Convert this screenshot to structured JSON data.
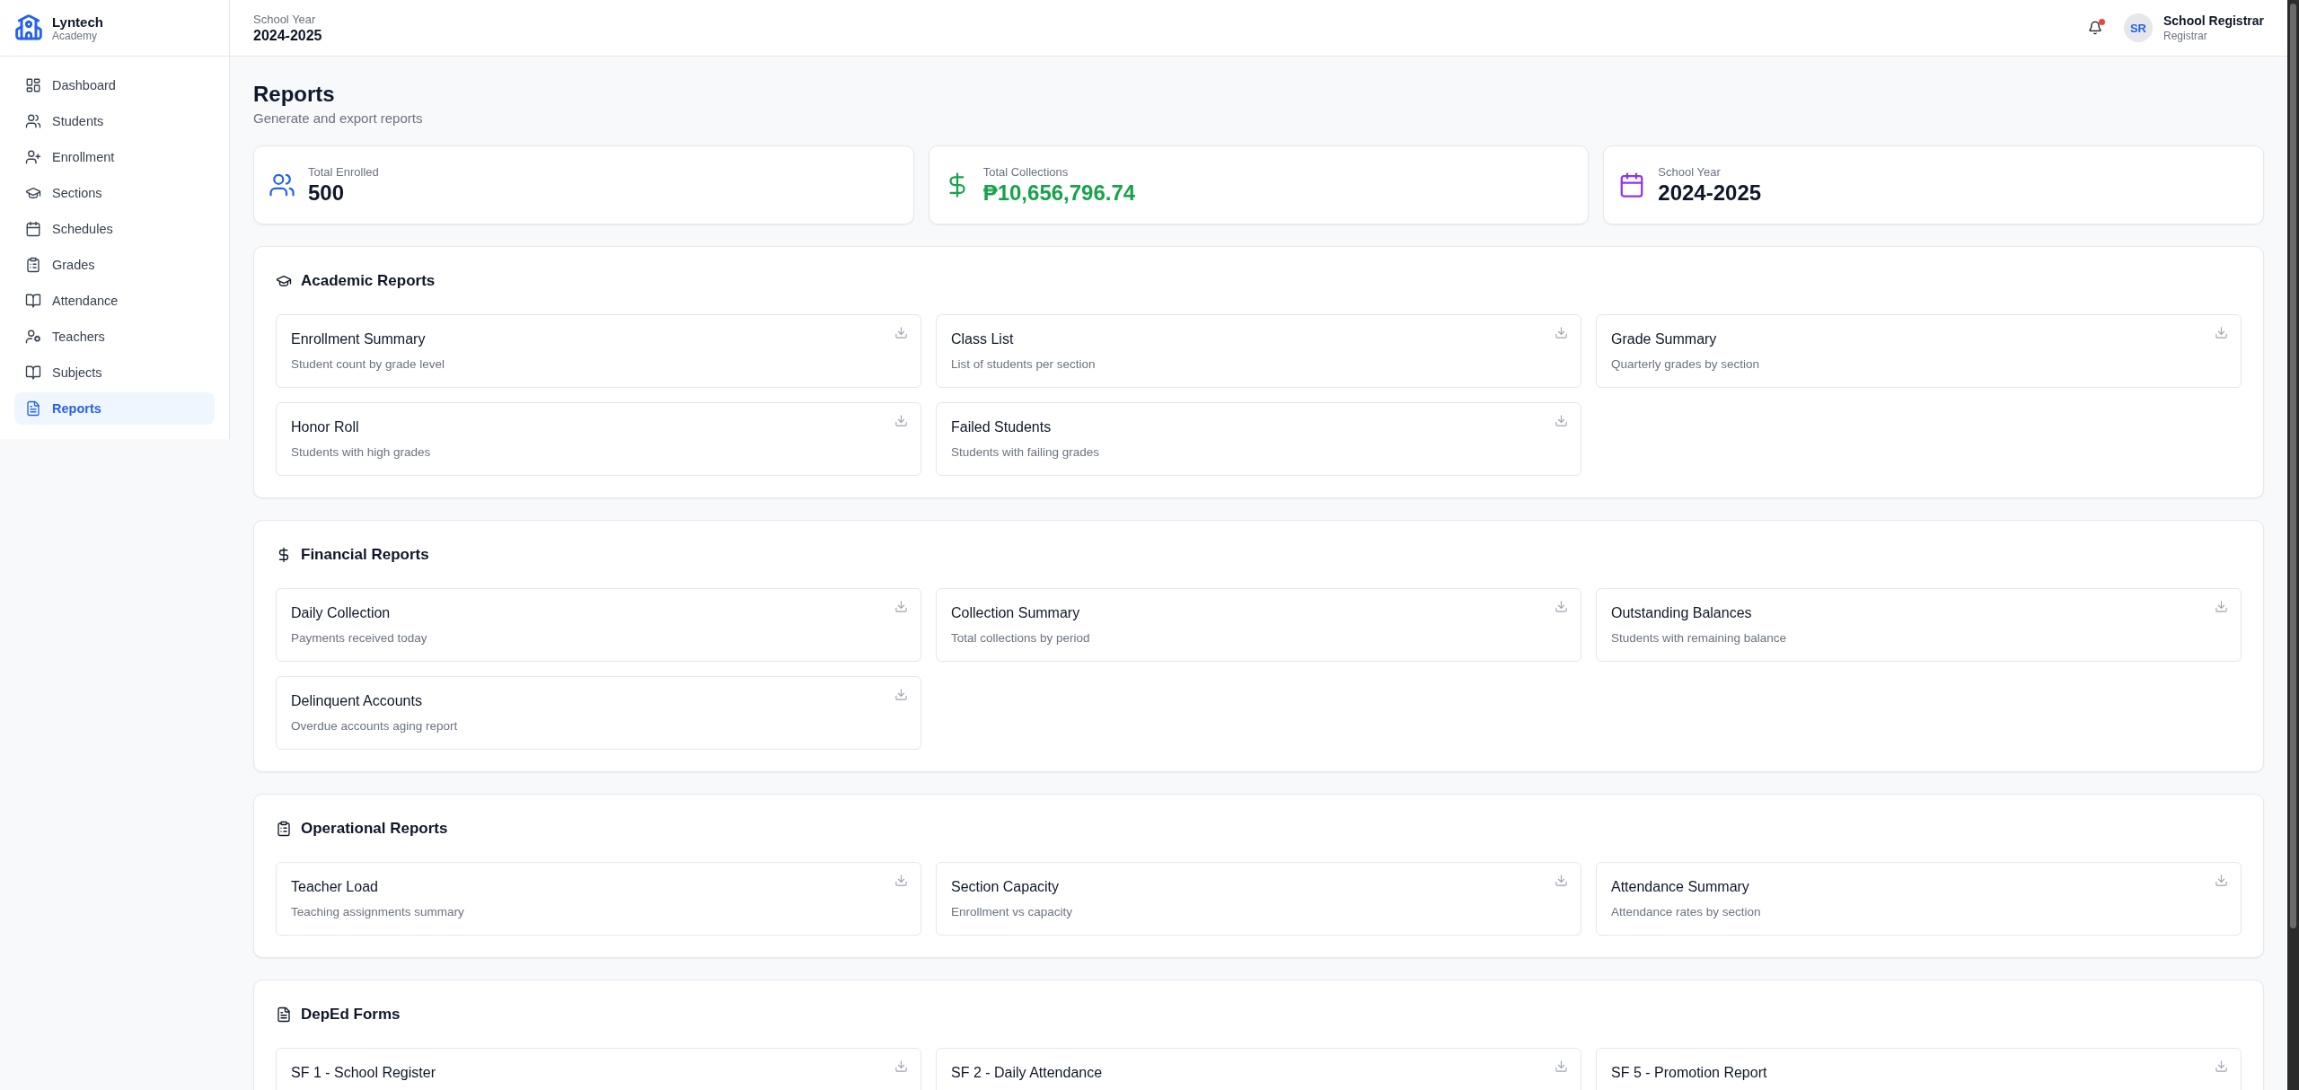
{
  "brand": {
    "name": "Lyntech",
    "subtitle": "Academy"
  },
  "sidebar": {
    "items": [
      {
        "label": "Dashboard",
        "selected": false
      },
      {
        "label": "Students",
        "selected": false
      },
      {
        "label": "Enrollment",
        "selected": false
      },
      {
        "label": "Sections",
        "selected": false
      },
      {
        "label": "Schedules",
        "selected": false
      },
      {
        "label": "Grades",
        "selected": false
      },
      {
        "label": "Attendance",
        "selected": false
      },
      {
        "label": "Teachers",
        "selected": false
      },
      {
        "label": "Subjects",
        "selected": false
      },
      {
        "label": "Reports",
        "selected": true
      }
    ]
  },
  "header": {
    "label": "School Year",
    "value": "2024-2025",
    "notifications": true,
    "user": {
      "initials": "SR",
      "name": "School Registrar",
      "role": "Registrar"
    }
  },
  "page": {
    "title": "Reports",
    "subtitle": "Generate and export reports"
  },
  "stats": [
    {
      "kind": "enrolled",
      "label": "Total Enrolled",
      "value": "500",
      "color": "#2563eb",
      "highlight": false
    },
    {
      "kind": "collections",
      "label": "Total Collections",
      "value": "₱10,656,796.74",
      "color": "#16a34a",
      "highlight": true
    },
    {
      "kind": "year",
      "label": "School Year",
      "value": "2024-2025",
      "color": "#9333ea",
      "highlight": false
    }
  ],
  "sections": [
    {
      "kind": "academic",
      "title": "Academic Reports",
      "reports": [
        {
          "title": "Enrollment Summary",
          "description": "Student count by grade level"
        },
        {
          "title": "Class List",
          "description": "List of students per section"
        },
        {
          "title": "Grade Summary",
          "description": "Quarterly grades by section"
        },
        {
          "title": "Honor Roll",
          "description": "Students with high grades"
        },
        {
          "title": "Failed Students",
          "description": "Students with failing grades"
        }
      ]
    },
    {
      "kind": "financial",
      "title": "Financial Reports",
      "reports": [
        {
          "title": "Daily Collection",
          "description": "Payments received today"
        },
        {
          "title": "Collection Summary",
          "description": "Total collections by period"
        },
        {
          "title": "Outstanding Balances",
          "description": "Students with remaining balance"
        },
        {
          "title": "Delinquent Accounts",
          "description": "Overdue accounts aging report"
        }
      ]
    },
    {
      "kind": "operational",
      "title": "Operational Reports",
      "reports": [
        {
          "title": "Teacher Load",
          "description": "Teaching assignments summary"
        },
        {
          "title": "Section Capacity",
          "description": "Enrollment vs capacity"
        },
        {
          "title": "Attendance Summary",
          "description": "Attendance rates by section"
        }
      ]
    },
    {
      "kind": "forms",
      "title": "DepEd Forms",
      "reports": [
        {
          "title": "SF 1 - School Register"
        },
        {
          "title": "SF 2 - Daily Attendance"
        },
        {
          "title": "SF 5 - Promotion Report"
        }
      ]
    }
  ]
}
